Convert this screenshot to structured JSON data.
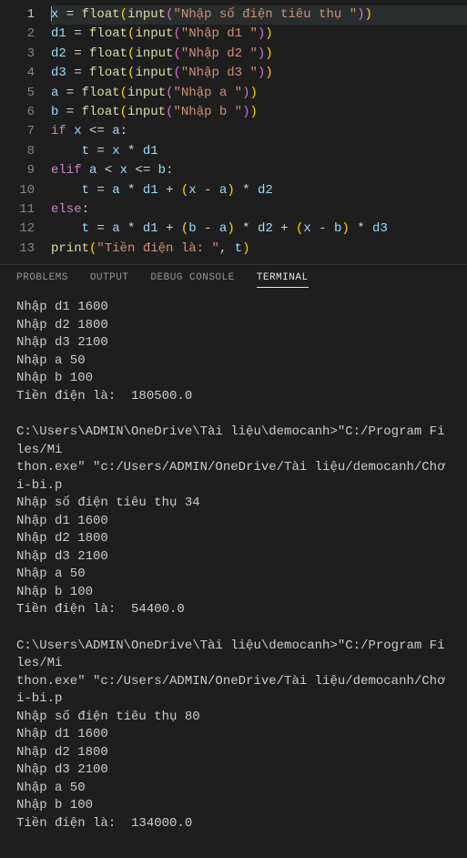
{
  "editor": {
    "lines": [
      {
        "n": 1,
        "active": true,
        "tokens": [
          [
            "var",
            "x"
          ],
          [
            "op",
            " = "
          ],
          [
            "fn",
            "float"
          ],
          [
            "par",
            "("
          ],
          [
            "fn",
            "input"
          ],
          [
            "par2",
            "("
          ],
          [
            "str",
            "\"Nhập số điện tiêu thụ \""
          ],
          [
            "par2",
            ")"
          ],
          [
            "par",
            ")"
          ]
        ]
      },
      {
        "n": 2,
        "tokens": [
          [
            "var",
            "d1"
          ],
          [
            "op",
            " = "
          ],
          [
            "fn",
            "float"
          ],
          [
            "par",
            "("
          ],
          [
            "fn",
            "input"
          ],
          [
            "par2",
            "("
          ],
          [
            "str",
            "\"Nhập d1 \""
          ],
          [
            "par2",
            ")"
          ],
          [
            "par",
            ")"
          ]
        ]
      },
      {
        "n": 3,
        "tokens": [
          [
            "var",
            "d2"
          ],
          [
            "op",
            " = "
          ],
          [
            "fn",
            "float"
          ],
          [
            "par",
            "("
          ],
          [
            "fn",
            "input"
          ],
          [
            "par2",
            "("
          ],
          [
            "str",
            "\"Nhập d2 \""
          ],
          [
            "par2",
            ")"
          ],
          [
            "par",
            ")"
          ]
        ]
      },
      {
        "n": 4,
        "tokens": [
          [
            "var",
            "d3"
          ],
          [
            "op",
            " = "
          ],
          [
            "fn",
            "float"
          ],
          [
            "par",
            "("
          ],
          [
            "fn",
            "input"
          ],
          [
            "par2",
            "("
          ],
          [
            "str",
            "\"Nhập d3 \""
          ],
          [
            "par2",
            ")"
          ],
          [
            "par",
            ")"
          ]
        ]
      },
      {
        "n": 5,
        "tokens": [
          [
            "var",
            "a"
          ],
          [
            "op",
            " = "
          ],
          [
            "fn",
            "float"
          ],
          [
            "par",
            "("
          ],
          [
            "fn",
            "input"
          ],
          [
            "par2",
            "("
          ],
          [
            "str",
            "\"Nhập a \""
          ],
          [
            "par2",
            ")"
          ],
          [
            "par",
            ")"
          ]
        ]
      },
      {
        "n": 6,
        "tokens": [
          [
            "var",
            "b"
          ],
          [
            "op",
            " = "
          ],
          [
            "fn",
            "float"
          ],
          [
            "par",
            "("
          ],
          [
            "fn",
            "input"
          ],
          [
            "par2",
            "("
          ],
          [
            "str",
            "\"Nhập b \""
          ],
          [
            "par2",
            ")"
          ],
          [
            "par",
            ")"
          ]
        ]
      },
      {
        "n": 7,
        "tokens": [
          [
            "kw",
            "if"
          ],
          [
            "op",
            " "
          ],
          [
            "var",
            "x"
          ],
          [
            "op",
            " <= "
          ],
          [
            "var",
            "a"
          ],
          [
            "pun",
            ":"
          ]
        ]
      },
      {
        "n": 8,
        "tokens": [
          [
            "op",
            "    "
          ],
          [
            "var",
            "t"
          ],
          [
            "op",
            " = "
          ],
          [
            "var",
            "x"
          ],
          [
            "op",
            " * "
          ],
          [
            "var",
            "d1"
          ]
        ]
      },
      {
        "n": 9,
        "tokens": [
          [
            "kw",
            "elif"
          ],
          [
            "op",
            " "
          ],
          [
            "var",
            "a"
          ],
          [
            "op",
            " < "
          ],
          [
            "var",
            "x"
          ],
          [
            "op",
            " <= "
          ],
          [
            "var",
            "b"
          ],
          [
            "pun",
            ":"
          ]
        ]
      },
      {
        "n": 10,
        "tokens": [
          [
            "op",
            "    "
          ],
          [
            "var",
            "t"
          ],
          [
            "op",
            " = "
          ],
          [
            "var",
            "a"
          ],
          [
            "op",
            " * "
          ],
          [
            "var",
            "d1"
          ],
          [
            "op",
            " + "
          ],
          [
            "par",
            "("
          ],
          [
            "var",
            "x"
          ],
          [
            "op",
            " - "
          ],
          [
            "var",
            "a"
          ],
          [
            "par",
            ")"
          ],
          [
            "op",
            " * "
          ],
          [
            "var",
            "d2"
          ]
        ]
      },
      {
        "n": 11,
        "tokens": [
          [
            "kw",
            "else"
          ],
          [
            "pun",
            ":"
          ]
        ]
      },
      {
        "n": 12,
        "tokens": [
          [
            "op",
            "    "
          ],
          [
            "var",
            "t"
          ],
          [
            "op",
            " = "
          ],
          [
            "var",
            "a"
          ],
          [
            "op",
            " * "
          ],
          [
            "var",
            "d1"
          ],
          [
            "op",
            " + "
          ],
          [
            "par",
            "("
          ],
          [
            "var",
            "b"
          ],
          [
            "op",
            " - "
          ],
          [
            "var",
            "a"
          ],
          [
            "par",
            ")"
          ],
          [
            "op",
            " * "
          ],
          [
            "var",
            "d2"
          ],
          [
            "op",
            " + "
          ],
          [
            "par",
            "("
          ],
          [
            "var",
            "x"
          ],
          [
            "op",
            " - "
          ],
          [
            "var",
            "b"
          ],
          [
            "par",
            ")"
          ],
          [
            "op",
            " * "
          ],
          [
            "var",
            "d3"
          ]
        ]
      },
      {
        "n": 13,
        "tokens": [
          [
            "fn",
            "print"
          ],
          [
            "par",
            "("
          ],
          [
            "str",
            "\"Tiền điện là: \""
          ],
          [
            "pun",
            ", "
          ],
          [
            "var",
            "t"
          ],
          [
            "par",
            ")"
          ]
        ]
      }
    ]
  },
  "panel": {
    "tabs": [
      {
        "id": "problems",
        "label": "PROBLEMS",
        "active": false
      },
      {
        "id": "output",
        "label": "OUTPUT",
        "active": false
      },
      {
        "id": "debug",
        "label": "DEBUG CONSOLE",
        "active": false
      },
      {
        "id": "terminal",
        "label": "TERMINAL",
        "active": true
      }
    ]
  },
  "terminal": {
    "blocks": [
      "Nhập d1 1600\nNhập d2 1800\nNhập d3 2100\nNhập a 50\nNhập b 100\nTiền điện là:  180500.0",
      "C:\\Users\\ADMIN\\OneDrive\\Tài liệu\\democanh>\"C:/Program Files/Mi\nthon.exe\" \"c:/Users/ADMIN/OneDrive/Tài liệu/democanh/Chơi-bi.p\nNhập số điện tiêu thụ 34\nNhập d1 1600\nNhập d2 1800\nNhập d3 2100\nNhập a 50\nNhập b 100\nTiền điện là:  54400.0",
      "C:\\Users\\ADMIN\\OneDrive\\Tài liệu\\democanh>\"C:/Program Files/Mi\nthon.exe\" \"c:/Users/ADMIN/OneDrive/Tài liệu/democanh/Chơi-bi.p\nNhập số điện tiêu thụ 80\nNhập d1 1600\nNhập d2 1800\nNhập d3 2100\nNhập a 50\nNhập b 100\nTiền điện là:  134000.0"
    ]
  }
}
